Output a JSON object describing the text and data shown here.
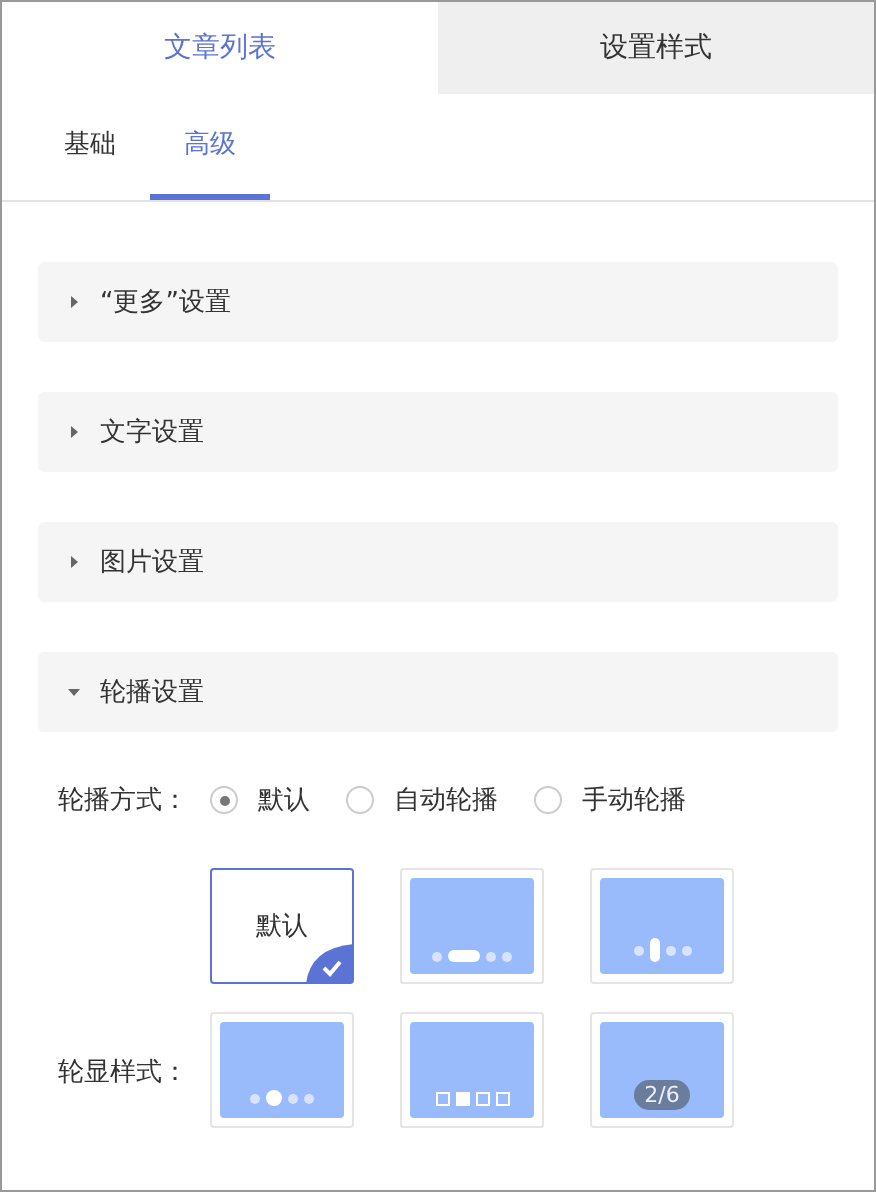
{
  "tabs": [
    {
      "label": "文章列表",
      "selected": true
    },
    {
      "label": "设置样式",
      "selected": false
    }
  ],
  "subtabs": [
    {
      "label": "基础",
      "selected": false
    },
    {
      "label": "高级",
      "selected": true
    }
  ],
  "sections": [
    {
      "title": "“更多”设置",
      "expanded": false
    },
    {
      "title": "文字设置",
      "expanded": false
    },
    {
      "title": "图片设置",
      "expanded": false
    },
    {
      "title": "轮播设置",
      "expanded": true
    }
  ],
  "carousel_mode": {
    "label": "轮播方式：",
    "options": [
      {
        "label": "默认",
        "selected": true
      },
      {
        "label": "自动轮播",
        "selected": false
      },
      {
        "label": "手动轮播",
        "selected": false
      }
    ]
  },
  "display_style": {
    "label": "轮显样式：",
    "options": [
      {
        "kind": "text",
        "label": "默认",
        "selected": true
      },
      {
        "kind": "bar",
        "selected": false
      },
      {
        "kind": "vertical",
        "selected": false
      },
      {
        "kind": "bigdot",
        "selected": false
      },
      {
        "kind": "squares",
        "selected": false
      },
      {
        "kind": "counter",
        "label": "2/6",
        "selected": false
      }
    ]
  }
}
